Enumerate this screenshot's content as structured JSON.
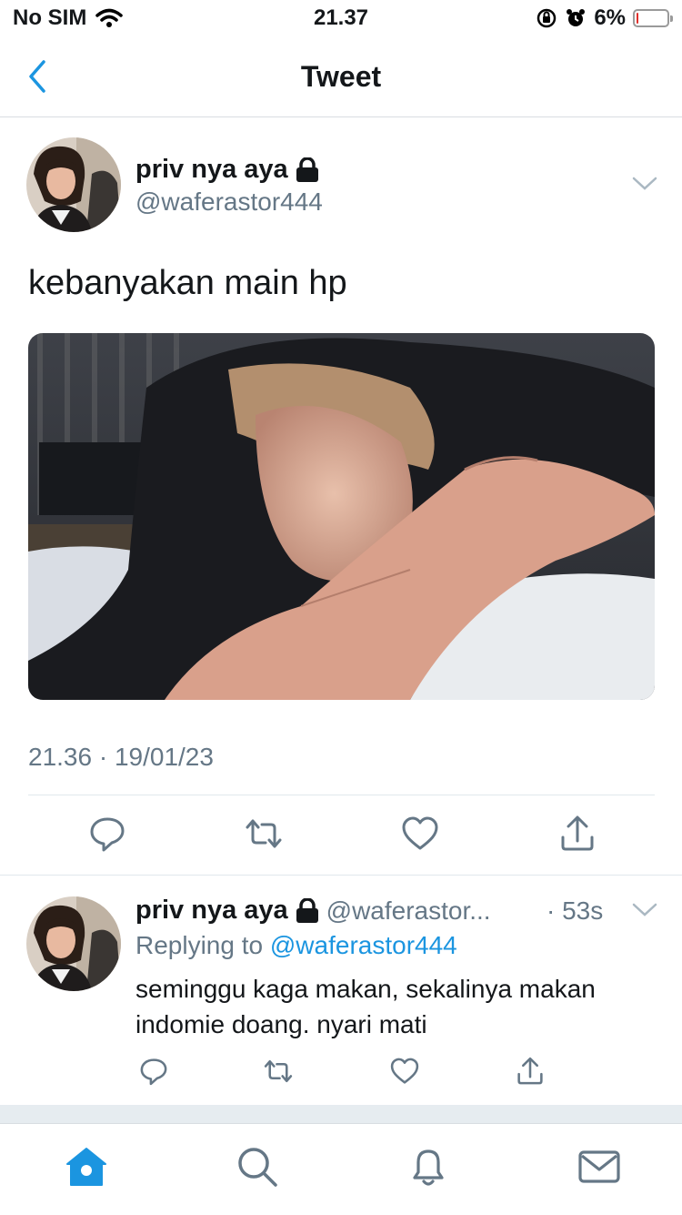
{
  "status_bar": {
    "carrier": "No SIM",
    "time": "21.37",
    "battery": "6%",
    "battery_level": 0.06
  },
  "header": {
    "title": "Tweet"
  },
  "tweet": {
    "display_name": "priv nya aya",
    "handle": "@waferastor444",
    "text": "kebanyakan main hp",
    "timestamp": "21.36 · 19/01/23"
  },
  "reply": {
    "display_name": "priv nya aya",
    "handle": "@waferastor...",
    "age": "· 53s",
    "replying_label": "Replying to",
    "replying_handle": "@waferastor444",
    "text": "seminggu kaga makan, sekalinya makan indomie doang. nyari mati"
  },
  "colors": {
    "accent": "#1b95e0",
    "secondary_text": "#657786",
    "divider": "#e1e8ed"
  },
  "icons": [
    "wifi-icon",
    "orientation-lock-icon",
    "alarm-icon",
    "battery-icon",
    "back-chevron-icon",
    "lock-icon",
    "chevron-down-icon",
    "reply-icon",
    "retweet-icon",
    "like-icon",
    "share-icon",
    "home-icon",
    "search-icon",
    "notifications-icon",
    "messages-icon"
  ]
}
